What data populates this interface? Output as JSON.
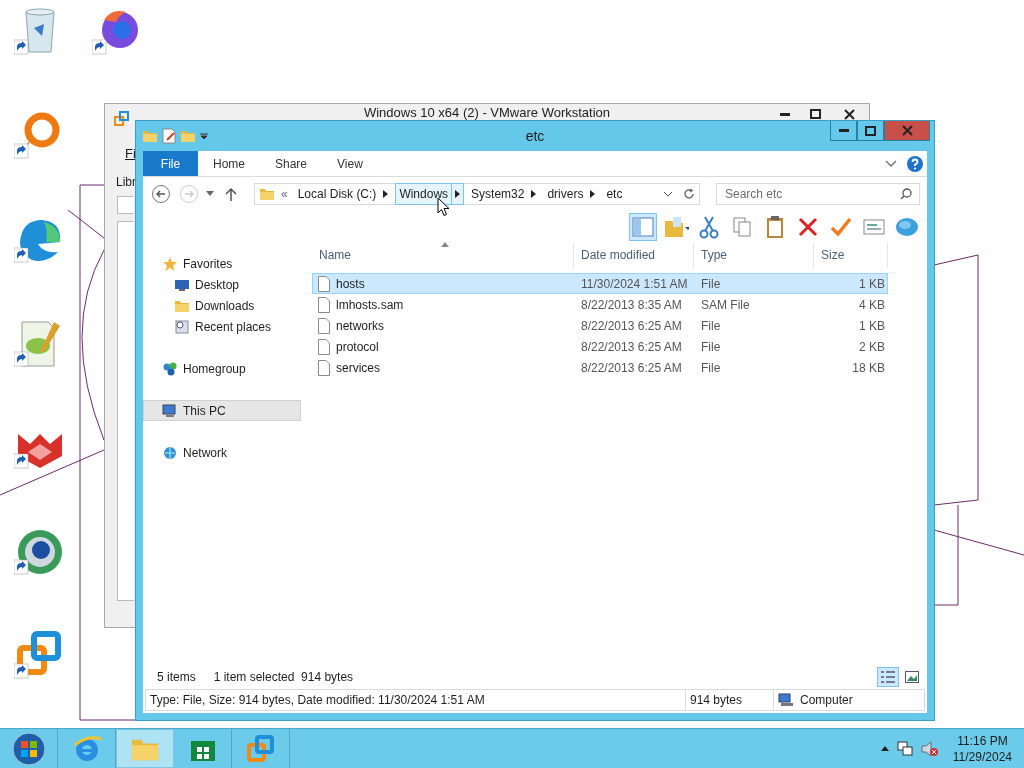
{
  "background_window": {
    "title": "Windows 10 x64 (2) - VMware Workstation",
    "menu_label": "Fi",
    "pane_label": "Libr"
  },
  "window": {
    "title": "etc",
    "ribbon_tabs": [
      {
        "label": "File",
        "kind": "file"
      },
      {
        "label": "Home",
        "kind": "tab"
      },
      {
        "label": "Share",
        "kind": "tab"
      },
      {
        "label": "View",
        "kind": "tab"
      }
    ],
    "address": {
      "overflow": "«",
      "crumbs": [
        {
          "label": "Local Disk (C:)",
          "hovered": false
        },
        {
          "label": "Windows",
          "hovered": true
        },
        {
          "label": "System32",
          "hovered": false
        },
        {
          "label": "drivers",
          "hovered": false
        },
        {
          "label": "etc",
          "hovered": false
        }
      ]
    },
    "search": {
      "placeholder": "Search etc"
    },
    "nav": [
      {
        "label": "Favorites",
        "kind": "favorites",
        "selected": false,
        "children": [
          {
            "label": "Desktop",
            "kind": "desktop",
            "selected": false
          },
          {
            "label": "Downloads",
            "kind": "downloads",
            "selected": false
          },
          {
            "label": "Recent places",
            "kind": "recent",
            "selected": false
          }
        ]
      },
      {
        "label": "Homegroup",
        "kind": "homegroup",
        "selected": false
      },
      {
        "label": "This PC",
        "kind": "pc",
        "selected": true
      },
      {
        "label": "Network",
        "kind": "network",
        "selected": false
      }
    ],
    "columns": [
      "Name",
      "Date modified",
      "Type",
      "Size"
    ],
    "rows": [
      {
        "name": "hosts",
        "date": "11/30/2024 1:51 AM",
        "type": "File",
        "size": "1 KB",
        "selected": true
      },
      {
        "name": "lmhosts.sam",
        "date": "8/22/2013 8:35 AM",
        "type": "SAM File",
        "size": "4 KB",
        "selected": false
      },
      {
        "name": "networks",
        "date": "8/22/2013 6:25 AM",
        "type": "File",
        "size": "1 KB",
        "selected": false
      },
      {
        "name": "protocol",
        "date": "8/22/2013 6:25 AM",
        "type": "File",
        "size": "2 KB",
        "selected": false
      },
      {
        "name": "services",
        "date": "8/22/2013 6:25 AM",
        "type": "File",
        "size": "18 KB",
        "selected": false
      }
    ],
    "status": {
      "count": "5 items",
      "selection": "1 item selected  914 bytes"
    },
    "details": {
      "text": "Type: File, Size: 914 bytes, Date modified: 11/30/2024 1:51 AM",
      "size": "914 bytes",
      "location": "Computer"
    }
  },
  "taskbar": {
    "buttons": [
      {
        "kind": "ie",
        "active": false
      },
      {
        "kind": "explorer",
        "active": true
      },
      {
        "kind": "store",
        "active": false
      },
      {
        "kind": "vmware",
        "active": false
      }
    ],
    "time": "11:16 PM",
    "date": "11/29/2024"
  }
}
